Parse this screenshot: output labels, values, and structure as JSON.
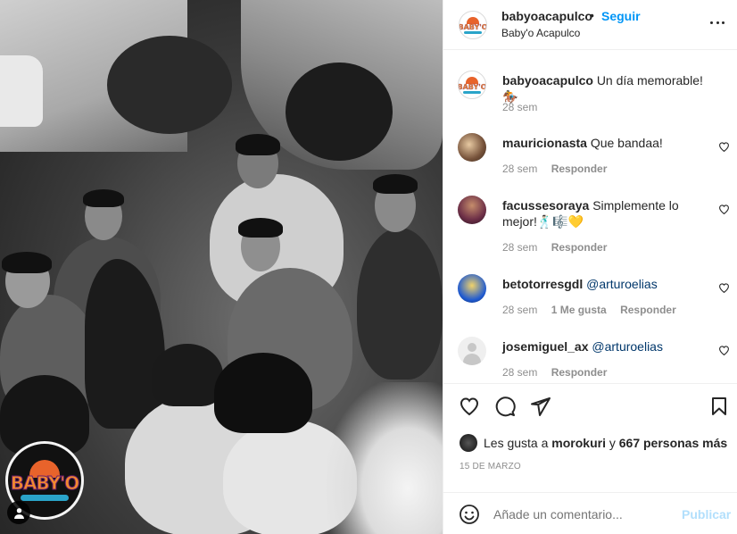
{
  "post": {
    "author": "babyoacapulco",
    "follow_label": "Seguir",
    "location": "Baby'o Acapulco",
    "logo_text": "BABY'O",
    "more_icon": "more-horizontal-icon"
  },
  "caption": {
    "username": "babyoacapulco",
    "text": "Un día memorable! 🏇",
    "time": "28 sem"
  },
  "comments": [
    {
      "username": "mauricionasta",
      "text": "Que bandaa!",
      "time": "28 sem",
      "likes": "",
      "reply": "Responder"
    },
    {
      "username": "facussesoraya",
      "text": "Simplemente lo mejor!🕺🏻🎼💛",
      "time": "28 sem",
      "likes": "",
      "reply": "Responder"
    },
    {
      "username": "betotorresgdl",
      "text": "@arturoelias",
      "time": "28 sem",
      "likes": "1 Me gusta",
      "reply": "Responder"
    },
    {
      "username": "josemiguel_ax",
      "text": "@arturoelias",
      "time": "28 sem",
      "likes": "",
      "reply": "Responder"
    }
  ],
  "engagement": {
    "likes_prefix": "Les gusta a",
    "liked_by": "morokuri",
    "likes_joiner": "y",
    "others": "667 personas más",
    "date": "15 DE MARZO"
  },
  "composer": {
    "placeholder": "Añade un comentario...",
    "publish_label": "Publicar"
  },
  "colors": {
    "link": "#0095f6",
    "publish_disabled": "#b2dffc",
    "muted": "#8e8e8e"
  }
}
